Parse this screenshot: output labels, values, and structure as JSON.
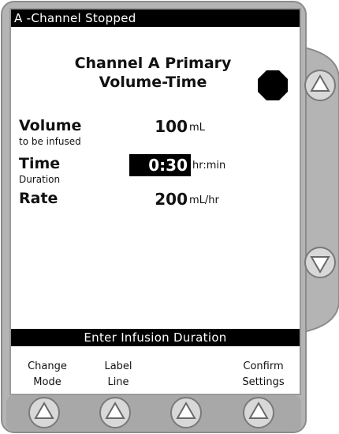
{
  "status": {
    "text": "A -Channel Stopped"
  },
  "title": {
    "line1": "Channel A Primary",
    "line2": "Volume-Time"
  },
  "fields": {
    "volume": {
      "label": "Volume",
      "sublabel": "to be infused",
      "value": "100",
      "unit": "mL"
    },
    "time": {
      "label": "Time",
      "sublabel": "Duration",
      "value": "0:30",
      "unit": "hr:min"
    },
    "rate": {
      "label": "Rate",
      "value": "200",
      "unit": "mL/hr"
    }
  },
  "prompt": {
    "text": "Enter Infusion Duration"
  },
  "softkeys": [
    {
      "line1": "Change",
      "line2": "Mode"
    },
    {
      "line1": "Label",
      "line2": "Line"
    },
    {
      "line1": "",
      "line2": ""
    },
    {
      "line1": "Confirm",
      "line2": "Settings"
    }
  ],
  "icons": {
    "stop": "stop-octagon-icon",
    "up": "up-arrow-icon",
    "down": "down-arrow-icon",
    "softkey": "softkey-arrow-icon"
  },
  "colors": {
    "bezel": "#b4b4b4",
    "bezel_dark": "#8c8c8c",
    "screen_bg": "#ffffff",
    "bar_bg": "#000000"
  }
}
